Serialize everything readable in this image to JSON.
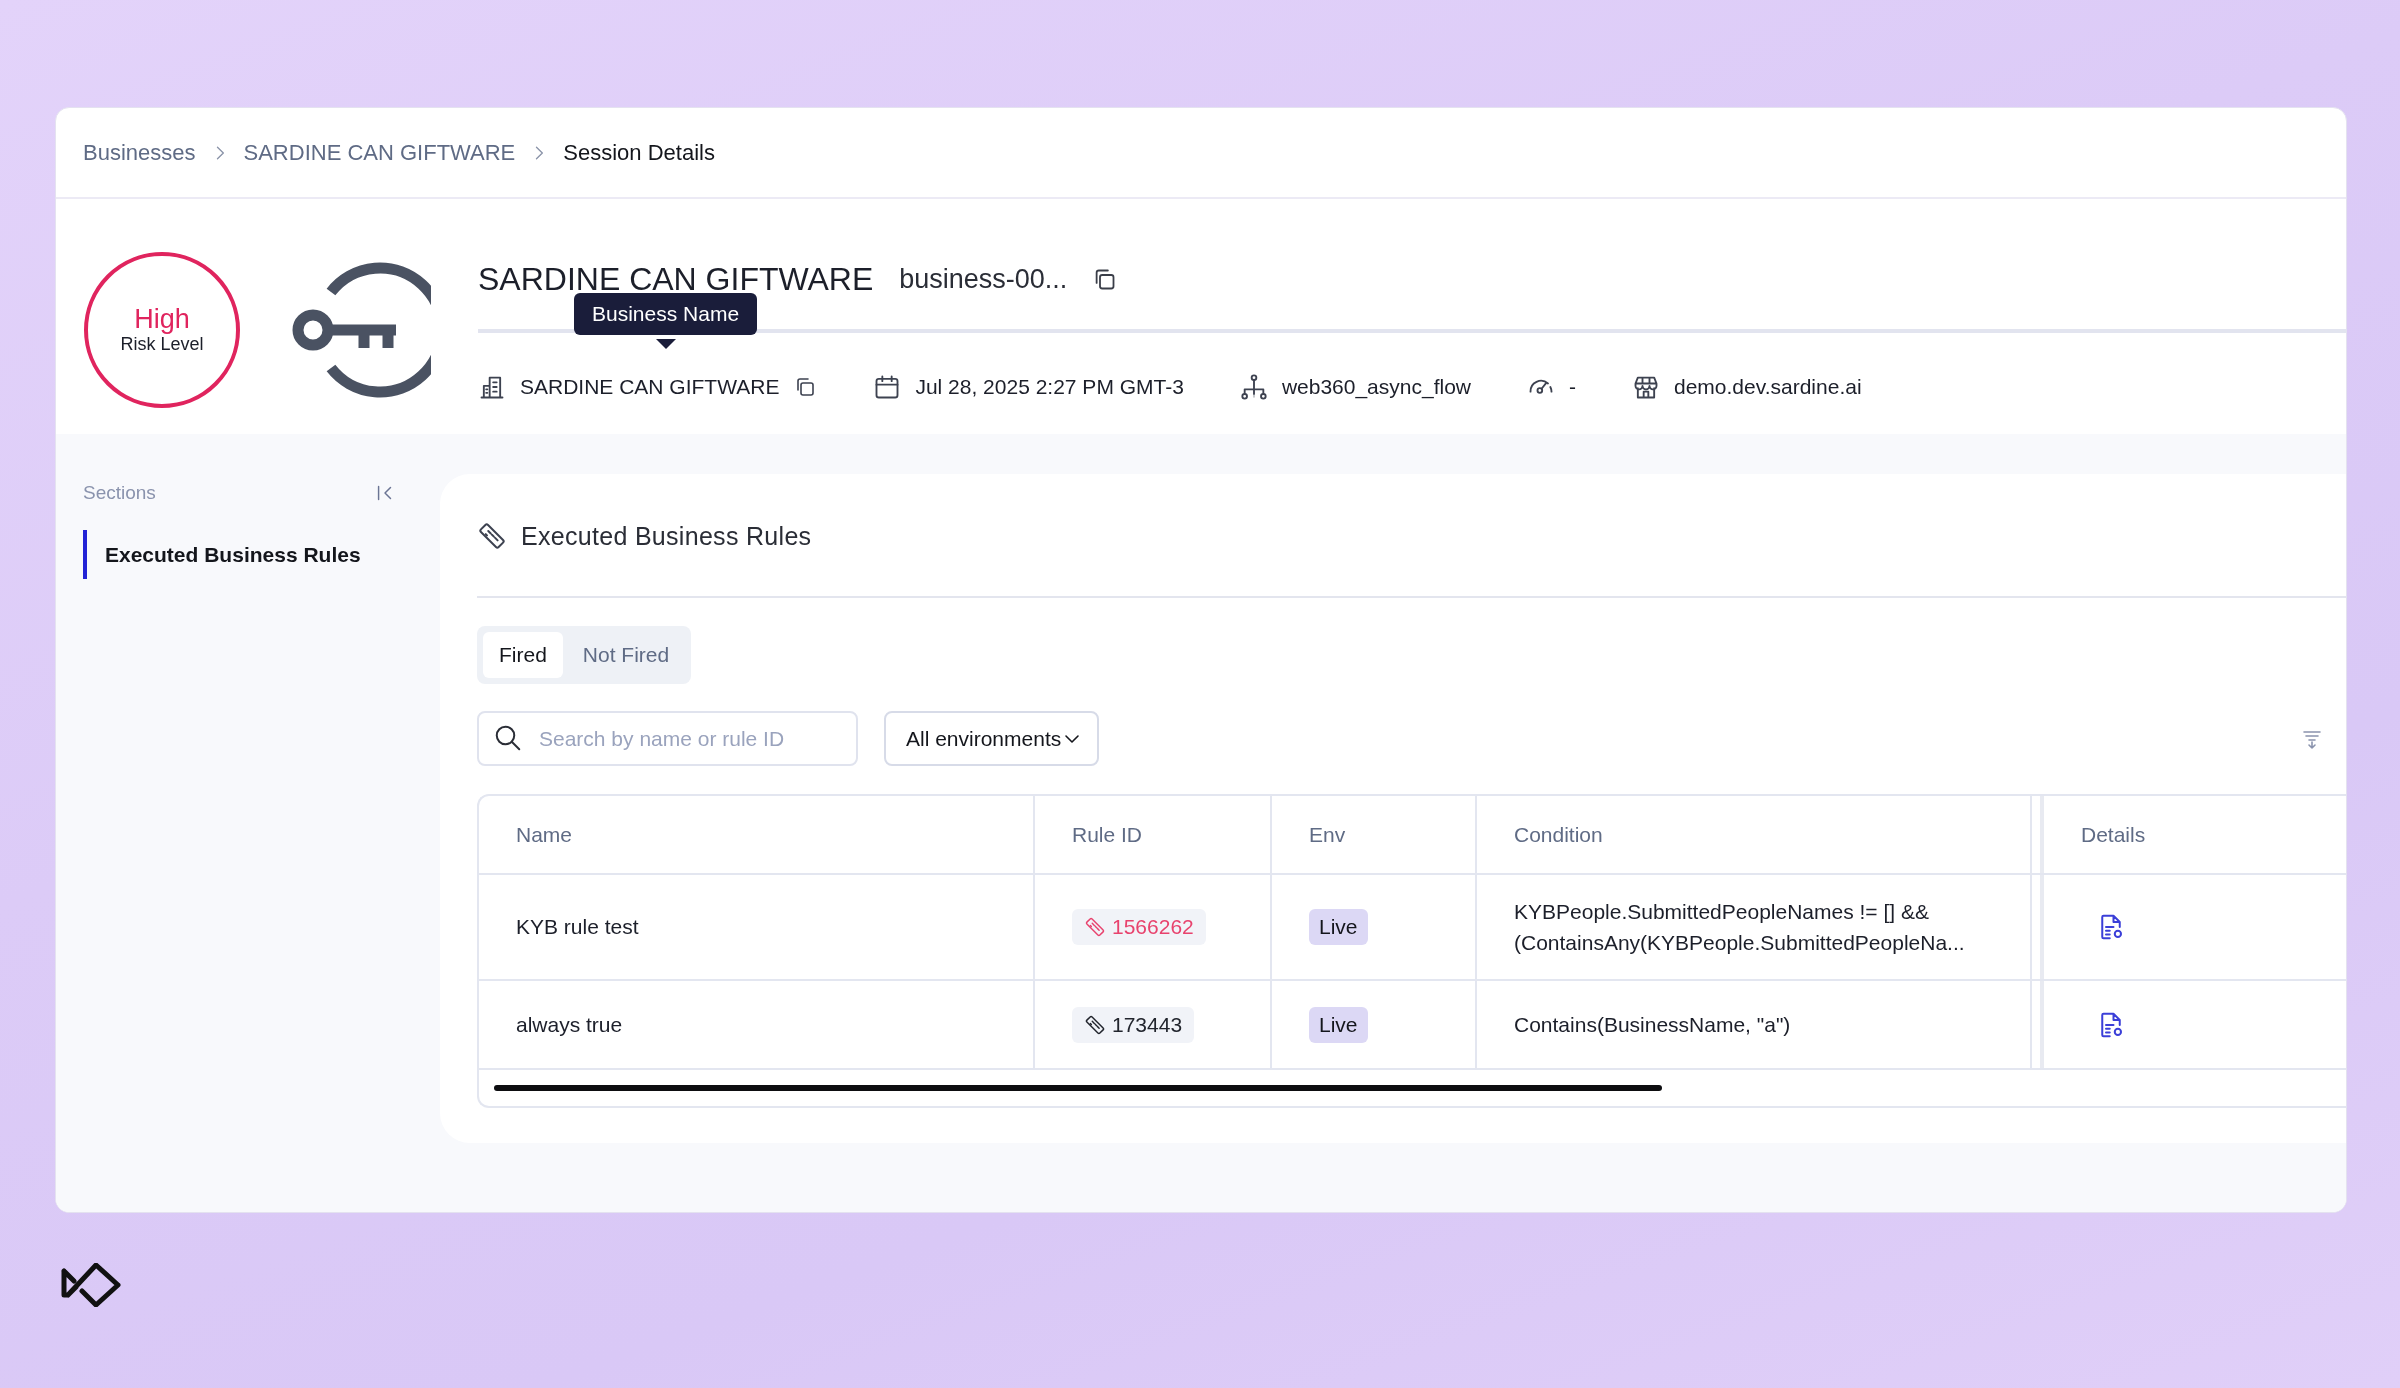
{
  "breadcrumbs": [
    {
      "label": "Businesses",
      "current": false
    },
    {
      "label": "SARDINE CAN GIFTWARE",
      "current": false
    },
    {
      "label": "Session Details",
      "current": true
    }
  ],
  "risk": {
    "level": "High",
    "label": "Risk Level"
  },
  "header": {
    "title": "SARDINE CAN GIFTWARE",
    "business_id": "business-00...",
    "tooltip": "Business Name"
  },
  "meta": [
    {
      "kind": "business",
      "text": "SARDINE CAN GIFTWARE",
      "copyable": true
    },
    {
      "kind": "date",
      "text": "Jul 28, 2025 2:27 PM GMT-3",
      "copyable": false
    },
    {
      "kind": "flow",
      "text": "web360_async_flow",
      "copyable": false
    },
    {
      "kind": "score",
      "text": "-",
      "copyable": false
    },
    {
      "kind": "store",
      "text": "demo.dev.sardine.ai",
      "copyable": false
    }
  ],
  "sidebar": {
    "title": "Sections",
    "items": [
      {
        "label": "Executed Business Rules",
        "selected": true
      }
    ]
  },
  "section": {
    "title": "Executed Business Rules",
    "tabs": [
      {
        "label": "Fired",
        "selected": true
      },
      {
        "label": "Not Fired",
        "selected": false
      }
    ],
    "search": {
      "placeholder": "Search by name or rule ID"
    },
    "environment": "All environments"
  },
  "table": {
    "columns": [
      "Name",
      "Rule ID",
      "Env",
      "Condition",
      "Details"
    ],
    "rows": [
      {
        "name": "KYB rule test",
        "rule_id": "1566262",
        "color": "#e8436e",
        "env": "Live",
        "condition": "KYBPeople.SubmittedPeopleNames != [] && (ContainsAny(KYBPeople.SubmittedPeopleNa..."
      },
      {
        "name": "always true",
        "rule_id": "173443",
        "color": "#22252d",
        "env": "Live",
        "condition": "Contains(BusinessName, \"a\")"
      }
    ]
  }
}
